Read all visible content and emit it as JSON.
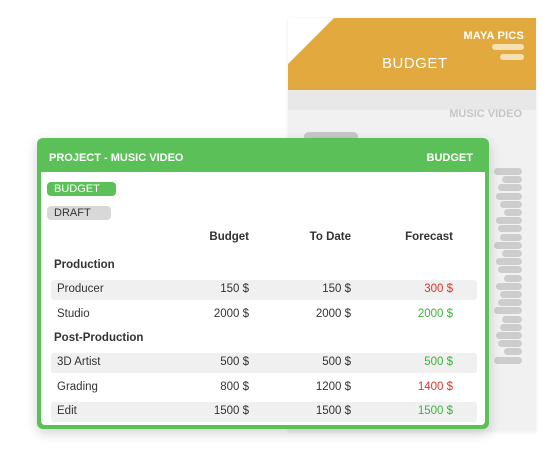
{
  "background_doc": {
    "brand": "MAYA PICS",
    "title": "BUDGET",
    "subtitle": "MUSIC VIDEO",
    "header_color": "#e2a93e"
  },
  "card": {
    "title": "PROJECT - MUSIC VIDEO",
    "tag": "BUDGET",
    "accent_color": "#5cc058",
    "chips": {
      "budget": "BUDGET",
      "draft": "DRAFT"
    },
    "columns": {
      "budget": "Budget",
      "todate": "To Date",
      "forecast": "Forecast"
    },
    "sections": [
      {
        "name": "Production",
        "rows": [
          {
            "name": "Producer",
            "budget": "150 $",
            "todate": "150 $",
            "forecast": "300 $",
            "status": "over"
          },
          {
            "name": "Studio",
            "budget": "2000 $",
            "todate": "2000 $",
            "forecast": "2000 $",
            "status": "ok"
          }
        ]
      },
      {
        "name": "Post-Production",
        "rows": [
          {
            "name": "3D Artist",
            "budget": "500 $",
            "todate": "500 $",
            "forecast": "500 $",
            "status": "ok"
          },
          {
            "name": "Grading",
            "budget": "800 $",
            "todate": "1200 $",
            "forecast": "1400 $",
            "status": "over"
          },
          {
            "name": "Edit",
            "budget": "1500 $",
            "todate": "1500 $",
            "forecast": "1500 $",
            "status": "ok"
          }
        ]
      }
    ],
    "status_colors": {
      "over": "#d9362b",
      "ok": "#3db23a"
    }
  }
}
